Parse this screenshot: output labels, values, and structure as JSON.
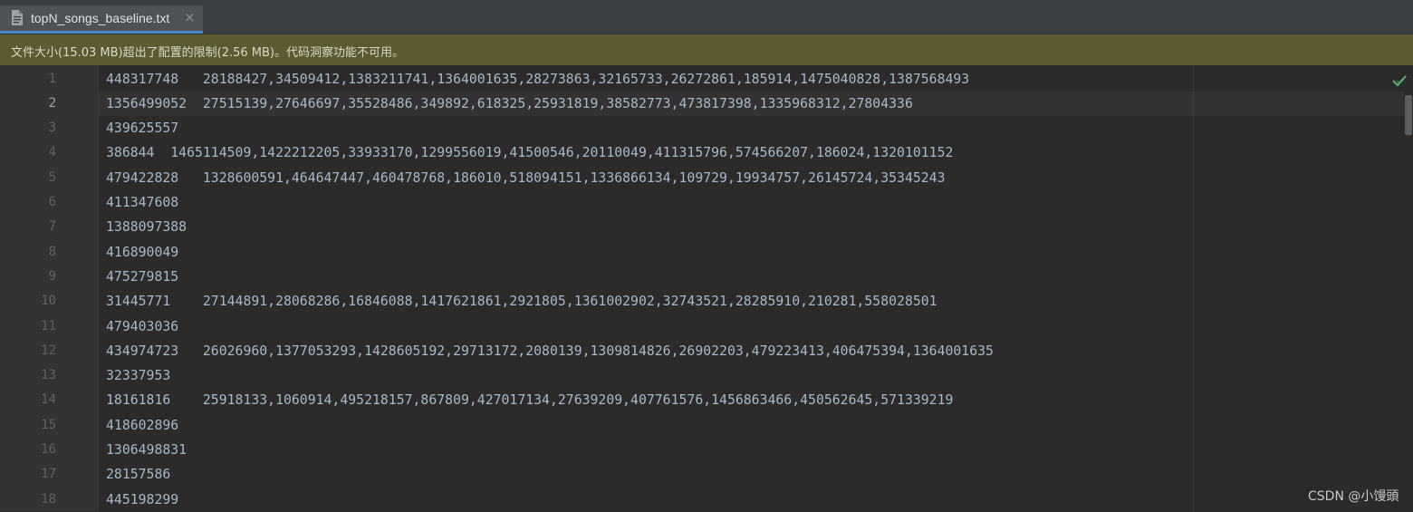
{
  "tab": {
    "filename": "topN_songs_baseline.txt",
    "close_glyph": "×",
    "icon": "text-file-icon"
  },
  "banner": {
    "message": "文件大小(15.03 MB)超出了配置的限制(2.56 MB)。代码洞察功能不可用。"
  },
  "editor": {
    "current_line": 2,
    "lines": [
      {
        "number": "1",
        "text": "448317748   28188427,34509412,1383211741,1364001635,28273863,32165733,26272861,185914,1475040828,1387568493"
      },
      {
        "number": "2",
        "text": "1356499052  27515139,27646697,35528486,349892,618325,25931819,38582773,473817398,1335968312,27804336"
      },
      {
        "number": "3",
        "text": "439625557"
      },
      {
        "number": "4",
        "text": "386844  1465114509,1422212205,33933170,1299556019,41500546,20110049,411315796,574566207,186024,1320101152"
      },
      {
        "number": "5",
        "text": "479422828   1328600591,464647447,460478768,186010,518094151,1336866134,109729,19934757,26145724,35345243"
      },
      {
        "number": "6",
        "text": "411347608"
      },
      {
        "number": "7",
        "text": "1388097388"
      },
      {
        "number": "8",
        "text": "416890049"
      },
      {
        "number": "9",
        "text": "475279815"
      },
      {
        "number": "10",
        "text": "31445771    27144891,28068286,16846088,1417621861,2921805,1361002902,32743521,28285910,210281,558028501"
      },
      {
        "number": "11",
        "text": "479403036"
      },
      {
        "number": "12",
        "text": "434974723   26026960,1377053293,1428605192,29713172,2080139,1309814826,26902203,479223413,406475394,1364001635"
      },
      {
        "number": "13",
        "text": "32337953"
      },
      {
        "number": "14",
        "text": "18161816    25918133,1060914,495218157,867809,427017134,27639209,407761576,1456863466,450562645,571339219"
      },
      {
        "number": "15",
        "text": "418602896"
      },
      {
        "number": "16",
        "text": "1306498831"
      },
      {
        "number": "17",
        "text": "28157586"
      },
      {
        "number": "18",
        "text": "445198299"
      }
    ]
  },
  "status": {
    "inspection_icon": "check-icon",
    "inspection_color": "#59a869"
  },
  "watermark": {
    "text": "CSDN @小馒頭"
  },
  "colors": {
    "background": "#2b2b2b",
    "gutter": "#313335",
    "banner": "#5c5a31",
    "text": "#a9b7c6",
    "tab_accent": "#4a88c7"
  }
}
